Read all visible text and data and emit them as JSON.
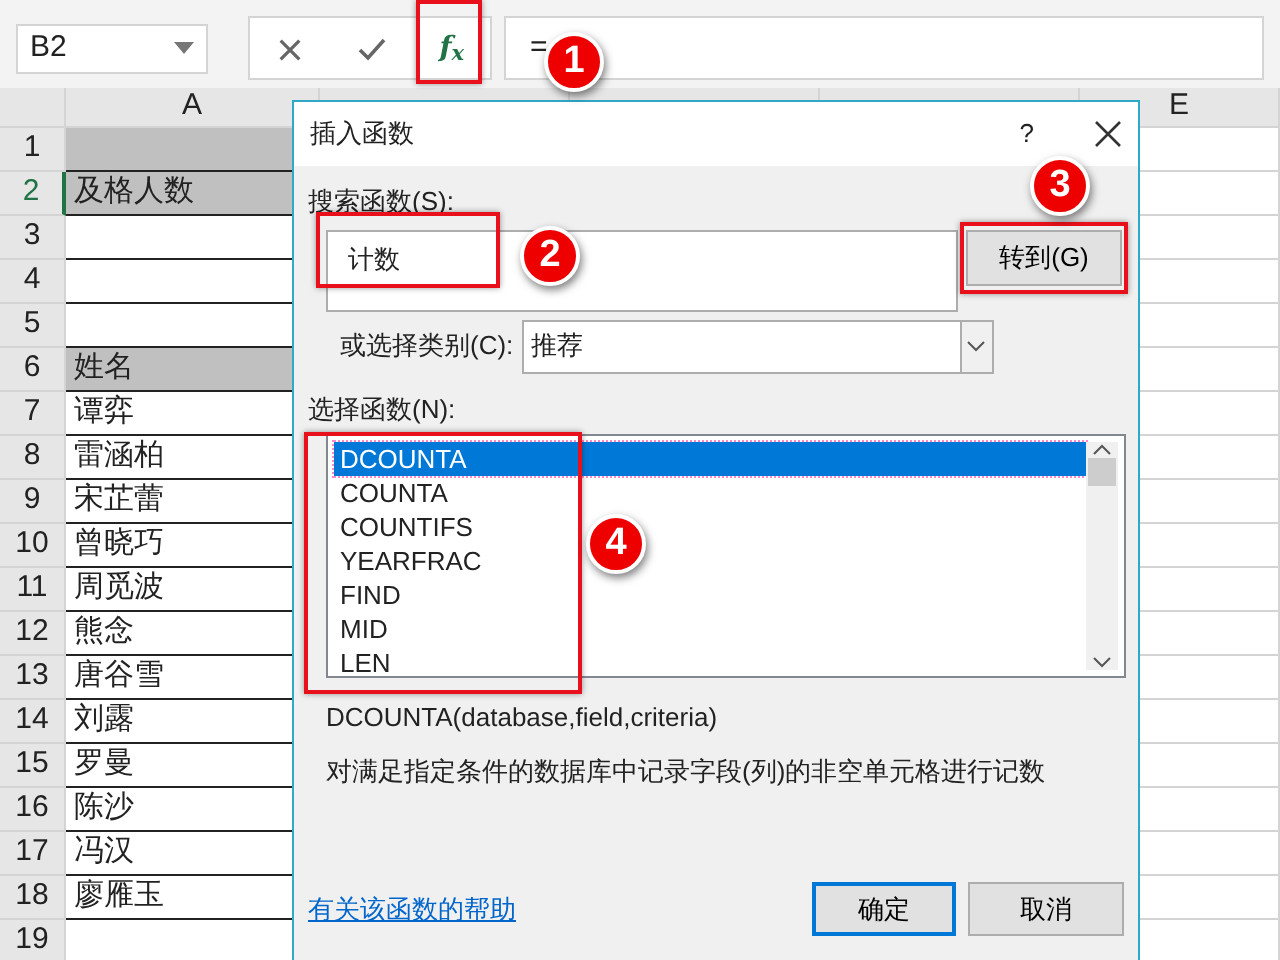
{
  "formula_bar": {
    "name_box": "B2",
    "fx_label": "f$_{x}$",
    "formula": "="
  },
  "column_headers": [
    "A",
    "E"
  ],
  "rows": [
    {
      "number": "1",
      "shaded": true,
      "selected": false
    },
    {
      "number": "2",
      "cell_a": "及格人数",
      "shaded": true,
      "selected": true
    },
    {
      "number": "3",
      "shaded": false,
      "selected": false
    },
    {
      "number": "4",
      "shaded": false,
      "selected": false
    },
    {
      "number": "5",
      "shaded": false,
      "selected": false
    },
    {
      "number": "6",
      "cell_a": "姓名",
      "shaded": true,
      "selected": false
    },
    {
      "number": "7",
      "cell_a": "谭弈",
      "shaded": false,
      "selected": false
    },
    {
      "number": "8",
      "cell_a": "雷涵柏",
      "shaded": false,
      "selected": false
    },
    {
      "number": "9",
      "cell_a": "宋芷蕾",
      "shaded": false,
      "selected": false
    },
    {
      "number": "10",
      "cell_a": "曾晓巧",
      "shaded": false,
      "selected": false
    },
    {
      "number": "11",
      "cell_a": "周觅波",
      "shaded": false,
      "selected": false
    },
    {
      "number": "12",
      "cell_a": "熊念",
      "shaded": false,
      "selected": false
    },
    {
      "number": "13",
      "cell_a": "唐谷雪",
      "shaded": false,
      "selected": false
    },
    {
      "number": "14",
      "cell_a": "刘露",
      "shaded": false,
      "selected": false
    },
    {
      "number": "15",
      "cell_a": "罗曼",
      "shaded": false,
      "selected": false
    },
    {
      "number": "16",
      "cell_a": "陈沙",
      "shaded": false,
      "selected": false
    },
    {
      "number": "17",
      "cell_a": "冯汉",
      "shaded": false,
      "selected": false
    },
    {
      "number": "18",
      "cell_a": "廖雁玉",
      "shaded": false,
      "selected": false
    },
    {
      "number": "19",
      "shaded": false,
      "selected": false
    }
  ],
  "dialog": {
    "title": "插入函数",
    "help_button": "?",
    "search_label": "搜索函数(S):",
    "search_value": "计数",
    "go_button": "转到(G)",
    "category_label": "或选择类别(C):",
    "category_value": "推荐",
    "functions_label": "选择函数(N):",
    "functions": [
      {
        "name": "DCOUNTA",
        "selected": true
      },
      {
        "name": "COUNTA",
        "selected": false
      },
      {
        "name": "COUNTIFS",
        "selected": false
      },
      {
        "name": "YEARFRAC",
        "selected": false
      },
      {
        "name": "FIND",
        "selected": false
      },
      {
        "name": "MID",
        "selected": false
      },
      {
        "name": "LEN",
        "selected": false
      }
    ],
    "signature": "DCOUNTA(database,field,criteria)",
    "description": "对满足指定条件的数据库中记录字段(列)的非空单元格进行记数",
    "help_link": "有关该函数的帮助",
    "ok_button": "确定",
    "cancel_button": "取消"
  },
  "callouts": [
    {
      "label": "1"
    },
    {
      "label": "2"
    },
    {
      "label": "3"
    },
    {
      "label": "4"
    }
  ]
}
